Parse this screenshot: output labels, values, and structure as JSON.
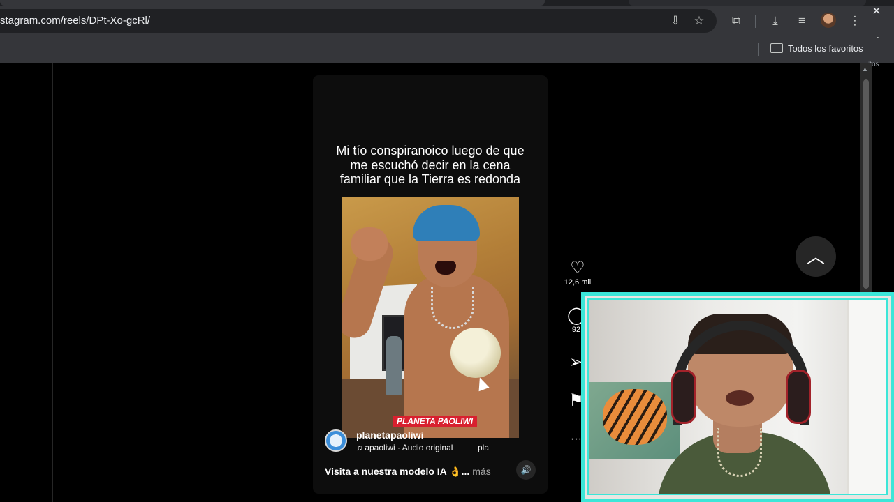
{
  "browser": {
    "url": "stagram.com/reels/DPt-Xo-gcRl/",
    "bookmarks_folder_label": "Todos los favoritos",
    "overflow_label": "itos",
    "close_glyph": "✕",
    "icons": {
      "install_app": "⇩",
      "bookmark_star": "☆",
      "extensions": "⧉",
      "downloads": "⤓",
      "media_controls": "≡",
      "menu": "⋮",
      "folder": "folder-icon"
    }
  },
  "reel": {
    "caption_overlay": "Mi tío conspiranoico luego de que\nme escuchó decir en la cena\nfamiliar que la Tierra es redonda",
    "brand_tag": "PLANETA PAOLIWI",
    "account_name": "planetapaoliwi",
    "audio_label": "♫ apaoliwi · Audio original",
    "audio_overflow": "pla",
    "description": "Visita a nuestra modelo IA 👌...",
    "more_label": "más",
    "mute_glyph": "🔊"
  },
  "actions": {
    "like": {
      "glyph": "♡",
      "count": "12,6 mil"
    },
    "comment": {
      "glyph": "◯",
      "count": "92"
    },
    "share": {
      "glyph": "➢",
      "count": ""
    },
    "save": {
      "glyph": "⚑",
      "count": ""
    },
    "more": {
      "glyph": "···",
      "count": ""
    },
    "scroll_up_glyph": "︿"
  },
  "colors": {
    "webcam_border": "#3ce6d8",
    "brand_tag_bg": "#d8212f",
    "chrome_bg": "#35363a",
    "page_bg": "#000000"
  }
}
